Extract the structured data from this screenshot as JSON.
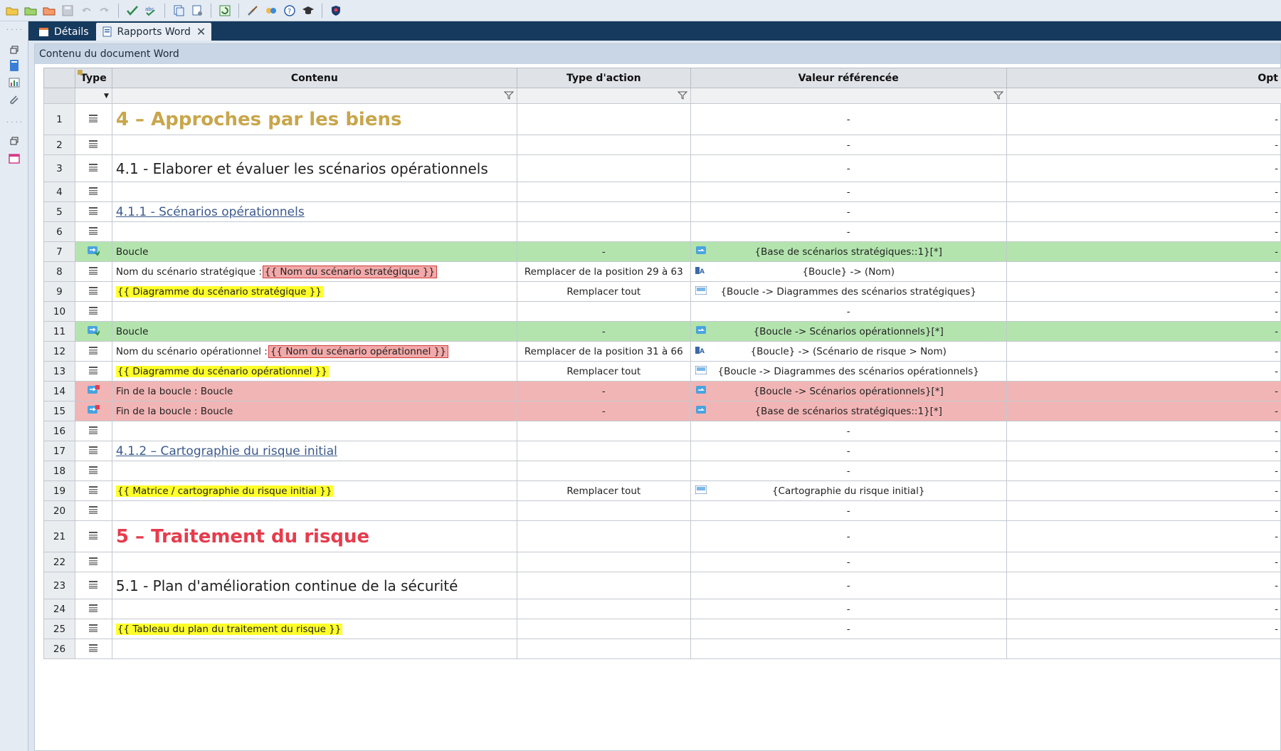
{
  "tabs": [
    {
      "label": "Détails",
      "active": false
    },
    {
      "label": "Rapports Word",
      "active": true
    }
  ],
  "panel": {
    "title": "Contenu du document Word"
  },
  "columns": {
    "type": "Type",
    "content": "Contenu",
    "action": "Type d'action",
    "ref": "Valeur référencée",
    "opt": "Opt"
  },
  "rows": [
    {
      "n": "1",
      "kind": "text",
      "style": "h1-gold",
      "content": "4 – Approches par les biens",
      "action": "",
      "ref": "-",
      "refIcon": "",
      "opt": "-"
    },
    {
      "n": "2",
      "kind": "text",
      "style": "",
      "content": "",
      "action": "",
      "ref": "-",
      "refIcon": "",
      "opt": "-"
    },
    {
      "n": "3",
      "kind": "text",
      "style": "h2",
      "content": "4.1 - Elaborer et évaluer les scénarios opérationnels",
      "action": "",
      "ref": "-",
      "refIcon": "",
      "opt": "-"
    },
    {
      "n": "4",
      "kind": "text",
      "style": "",
      "content": "",
      "action": "",
      "ref": "-",
      "refIcon": "",
      "opt": "-"
    },
    {
      "n": "5",
      "kind": "text",
      "style": "h3link",
      "content": "4.1.1 - Scénarios opérationnels",
      "action": "",
      "ref": "-",
      "refIcon": "",
      "opt": "-"
    },
    {
      "n": "6",
      "kind": "text",
      "style": "",
      "content": "",
      "action": "",
      "ref": "-",
      "refIcon": "",
      "opt": "-"
    },
    {
      "n": "7",
      "kind": "loop",
      "style": "",
      "content": "Boucle",
      "action": "-",
      "ref": "{Base de scénarios stratégiques::1}[*]",
      "refIcon": "loop",
      "opt": "-"
    },
    {
      "n": "8",
      "kind": "text",
      "style": "",
      "content": "Nom du scénario stratégique :",
      "tag": "{{ Nom du scénario stratégique }}",
      "tagStyle": "red",
      "action": "Remplacer de la position 29 à 63",
      "ref": "{Boucle} -> (Nom)",
      "refIcon": "text",
      "opt": "-"
    },
    {
      "n": "9",
      "kind": "text",
      "style": "",
      "content": "",
      "tag": "{{ Diagramme du scénario stratégique }}",
      "tagStyle": "yellow",
      "action": "Remplacer tout",
      "ref": "{Boucle -> Diagrammes des scénarios stratégiques}",
      "refIcon": "image",
      "opt": "-"
    },
    {
      "n": "10",
      "kind": "text",
      "style": "",
      "content": "",
      "action": "",
      "ref": "-",
      "refIcon": "",
      "opt": "-"
    },
    {
      "n": "11",
      "kind": "loop",
      "style": "",
      "content": "Boucle",
      "action": "-",
      "ref": "{Boucle -> Scénarios opérationnels}[*]",
      "refIcon": "loop",
      "opt": "-"
    },
    {
      "n": "12",
      "kind": "text",
      "style": "",
      "content": "Nom du scénario opérationnel :",
      "tag": "{{ Nom du scénario opérationnel }}",
      "tagStyle": "red",
      "action": "Remplacer de la position 31 à 66",
      "ref": "{Boucle} -> (Scénario de risque > Nom)",
      "refIcon": "text",
      "opt": "-"
    },
    {
      "n": "13",
      "kind": "text",
      "style": "",
      "content": "",
      "tag": "{{ Diagramme du scénario opérationnel }}",
      "tagStyle": "yellow",
      "action": "Remplacer tout",
      "ref": "{Boucle -> Diagrammes des scénarios opérationnels}",
      "refIcon": "image",
      "opt": "-"
    },
    {
      "n": "14",
      "kind": "endloop",
      "style": "",
      "content": "Fin de la boucle : Boucle",
      "action": "-",
      "ref": "{Boucle -> Scénarios opérationnels}[*]",
      "refIcon": "loop",
      "opt": "-"
    },
    {
      "n": "15",
      "kind": "endloop",
      "style": "",
      "content": "Fin de la boucle : Boucle",
      "action": "-",
      "ref": "{Base de scénarios stratégiques::1}[*]",
      "refIcon": "loop",
      "opt": "-"
    },
    {
      "n": "16",
      "kind": "text",
      "style": "",
      "content": "",
      "action": "",
      "ref": "-",
      "refIcon": "",
      "opt": "-"
    },
    {
      "n": "17",
      "kind": "text",
      "style": "h3link",
      "content": "4.1.2 – Cartographie du risque initial",
      "action": "",
      "ref": "-",
      "refIcon": "",
      "opt": "-"
    },
    {
      "n": "18",
      "kind": "text",
      "style": "",
      "content": "",
      "action": "",
      "ref": "-",
      "refIcon": "",
      "opt": "-"
    },
    {
      "n": "19",
      "kind": "text",
      "style": "",
      "content": "",
      "tag": "{{ Matrice / cartographie du risque initial }}",
      "tagStyle": "yellow",
      "action": "Remplacer tout",
      "ref": "{Cartographie du risque initial}",
      "refIcon": "image",
      "opt": "-"
    },
    {
      "n": "20",
      "kind": "text",
      "style": "",
      "content": "",
      "action": "",
      "ref": "-",
      "refIcon": "",
      "opt": "-"
    },
    {
      "n": "21",
      "kind": "text",
      "style": "h1-red",
      "content": "5 – Traitement du risque",
      "action": "",
      "ref": "-",
      "refIcon": "",
      "opt": "-"
    },
    {
      "n": "22",
      "kind": "text",
      "style": "",
      "content": "",
      "action": "",
      "ref": "-",
      "refIcon": "",
      "opt": "-"
    },
    {
      "n": "23",
      "kind": "text",
      "style": "h2",
      "content": "5.1 - Plan d'amélioration continue de la sécurité",
      "action": "",
      "ref": "-",
      "refIcon": "",
      "opt": "-"
    },
    {
      "n": "24",
      "kind": "text",
      "style": "",
      "content": "",
      "action": "",
      "ref": "-",
      "refIcon": "",
      "opt": "-"
    },
    {
      "n": "25",
      "kind": "text",
      "style": "",
      "content": "",
      "tag": "{{ Tableau du plan du traitement du risque }}",
      "tagStyle": "yellow",
      "action": "",
      "ref": "-",
      "refIcon": "",
      "opt": "-"
    },
    {
      "n": "26",
      "kind": "text",
      "style": "",
      "content": "",
      "action": "",
      "ref": "",
      "refIcon": "",
      "opt": ""
    }
  ],
  "colors": {
    "loop_row": "#b3e4ae",
    "endloop_row": "#f2b5b5",
    "tabbar": "#163a5e",
    "tag_yellow": "#ffff2a",
    "tag_red": "#f3a9a9"
  }
}
